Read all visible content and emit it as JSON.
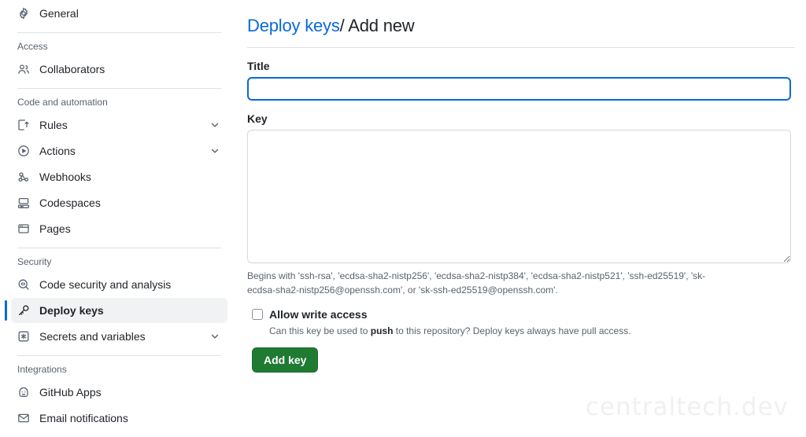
{
  "sidebar": {
    "groups": [
      {
        "title": null,
        "items": [
          {
            "label": "General",
            "icon": "gear-icon",
            "active": false,
            "expandable": false
          }
        ]
      },
      {
        "title": "Access",
        "items": [
          {
            "label": "Collaborators",
            "icon": "people-icon",
            "active": false,
            "expandable": false
          }
        ]
      },
      {
        "title": "Code and automation",
        "items": [
          {
            "label": "Rules",
            "icon": "rules-icon",
            "active": false,
            "expandable": true
          },
          {
            "label": "Actions",
            "icon": "play-circle-icon",
            "active": false,
            "expandable": true
          },
          {
            "label": "Webhooks",
            "icon": "webhook-icon",
            "active": false,
            "expandable": false
          },
          {
            "label": "Codespaces",
            "icon": "codespaces-icon",
            "active": false,
            "expandable": false
          },
          {
            "label": "Pages",
            "icon": "browser-window-icon",
            "active": false,
            "expandable": false
          }
        ]
      },
      {
        "title": "Security",
        "items": [
          {
            "label": "Code security and analysis",
            "icon": "code-scan-icon",
            "active": false,
            "expandable": false
          },
          {
            "label": "Deploy keys",
            "icon": "key-icon",
            "active": true,
            "expandable": false
          },
          {
            "label": "Secrets and variables",
            "icon": "asterisk-square-icon",
            "active": false,
            "expandable": true
          }
        ]
      },
      {
        "title": "Integrations",
        "items": [
          {
            "label": "GitHub Apps",
            "icon": "github-apps-icon",
            "active": false,
            "expandable": false
          },
          {
            "label": "Email notifications",
            "icon": "mail-icon",
            "active": false,
            "expandable": false
          }
        ]
      }
    ]
  },
  "main": {
    "breadcrumb": {
      "parent_link": "Deploy keys",
      "separator": "/",
      "current": "Add new"
    },
    "title_field": {
      "label": "Title",
      "value": "",
      "placeholder": ""
    },
    "key_field": {
      "label": "Key",
      "value": "",
      "placeholder": "",
      "help": "Begins with 'ssh-rsa', 'ecdsa-sha2-nistp256', 'ecdsa-sha2-nistp384', 'ecdsa-sha2-nistp521', 'ssh-ed25519', 'sk-ecdsa-sha2-nistp256@openssh.com', or 'sk-ssh-ed25519@openssh.com'."
    },
    "write_access": {
      "label": "Allow write access",
      "checked": false,
      "description_before": "Can this key be used to ",
      "description_bold": "push",
      "description_after": " to this repository? Deploy keys always have pull access."
    },
    "submit_button": "Add key"
  },
  "watermark": "centraltech.dev",
  "colors": {
    "accent_blue": "#0969da",
    "success_green": "#1f7a32",
    "border": "#d1d9e0",
    "muted_text": "#59636e",
    "active_bg": "#f1f2f4"
  }
}
